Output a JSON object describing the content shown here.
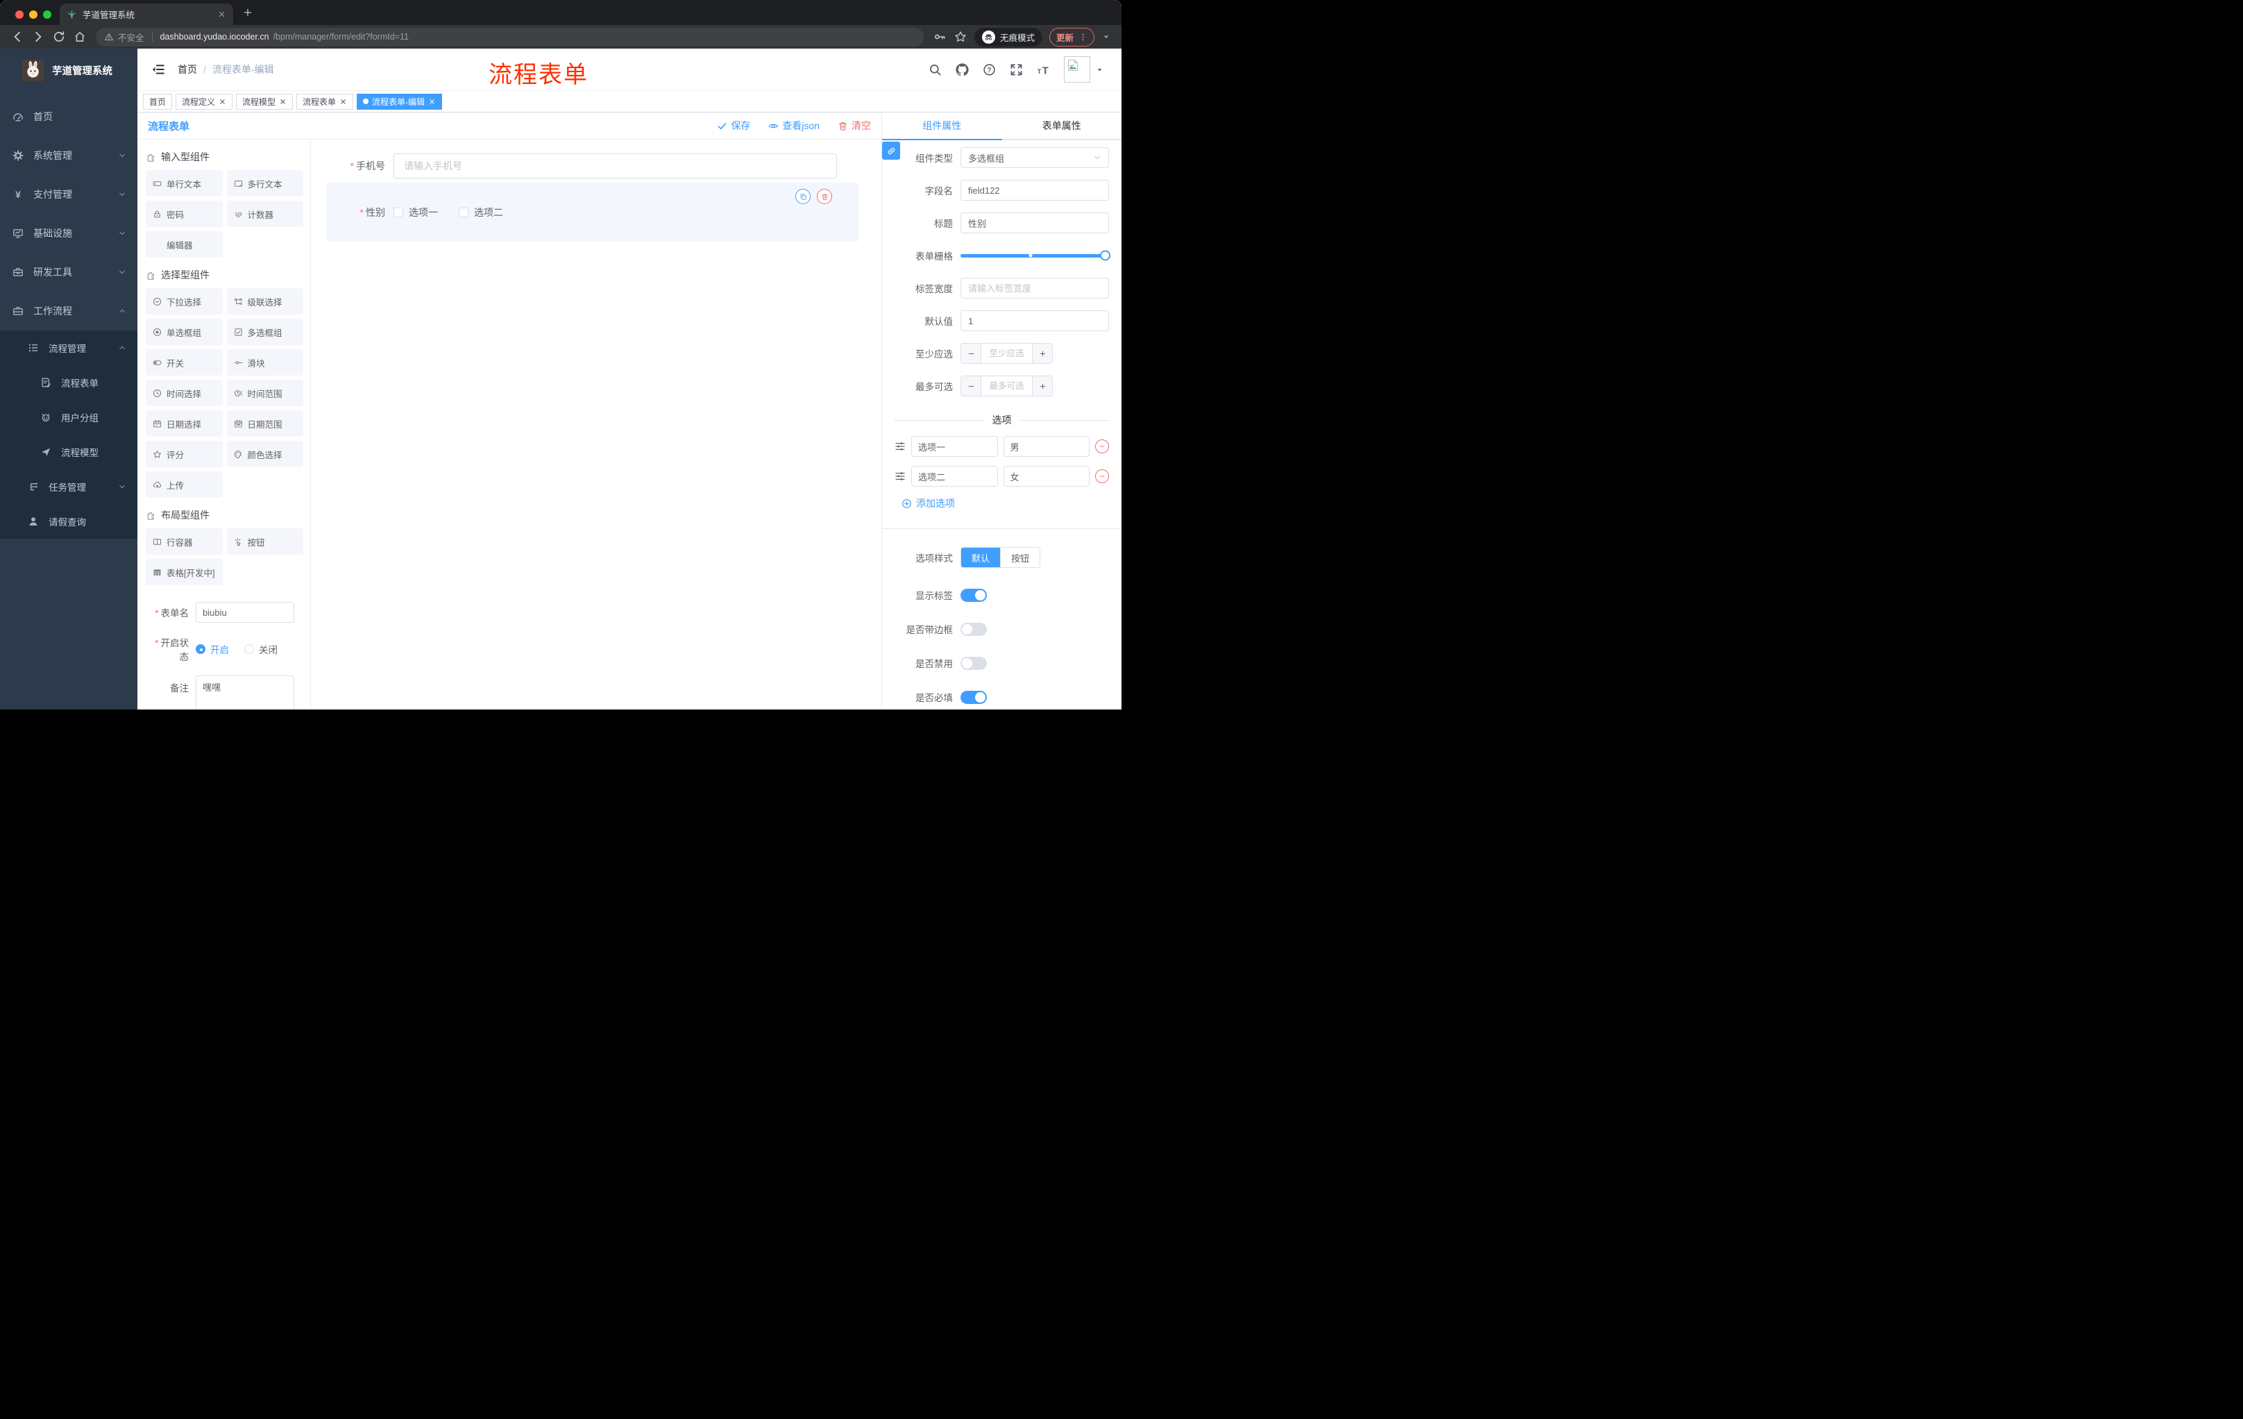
{
  "browser": {
    "tab_title": "芋道管理系统",
    "security_label": "不安全",
    "url_host": "dashboard.yudao.iocoder.cn",
    "url_path": "/bpm/manager/form/edit?formId=11",
    "incognito_label": "无痕模式",
    "update_label": "更新"
  },
  "sidebar": {
    "app_title": "芋道管理系统",
    "menu": [
      {
        "label": "首页",
        "icon": "dashboard",
        "level": 1
      },
      {
        "label": "系统管理",
        "icon": "gear",
        "level": 1,
        "chevron": "chev-down"
      },
      {
        "label": "支付管理",
        "icon": "yen",
        "level": 1,
        "chevron": "chev-down"
      },
      {
        "label": "基础设施",
        "icon": "monitor",
        "level": 1,
        "chevron": "chev-down"
      },
      {
        "label": "研发工具",
        "icon": "toolbox",
        "level": 1,
        "chevron": "chev-down"
      },
      {
        "label": "工作流程",
        "icon": "briefcase",
        "level": 1,
        "chevron": "chev-up"
      },
      {
        "label": "流程管理",
        "icon": "list-tree",
        "level": 2,
        "chevron": "chev-up",
        "dark": true
      },
      {
        "label": "流程表单",
        "icon": "doc-edit",
        "level": 3,
        "dark": true
      },
      {
        "label": "用户分组",
        "icon": "robot",
        "level": 3,
        "dark": true
      },
      {
        "label": "流程模型",
        "icon": "plane",
        "level": 3,
        "dark": true
      },
      {
        "label": "任务管理",
        "icon": "flow",
        "level": 2,
        "chevron": "chev-down",
        "dark": true
      },
      {
        "label": "请假查询",
        "icon": "user",
        "level": 2,
        "dark": true
      }
    ]
  },
  "navbar": {
    "breadcrumb_home": "首页",
    "breadcrumb_sep": "/",
    "breadcrumb_current": "流程表单-编辑",
    "watermark": "流程表单"
  },
  "tags": [
    {
      "label": "首页"
    },
    {
      "label": "流程定义",
      "closable": true
    },
    {
      "label": "流程模型",
      "closable": true
    },
    {
      "label": "流程表单",
      "closable": true
    },
    {
      "label": "流程表单-编辑",
      "closable": true,
      "active": true
    }
  ],
  "toolbar": {
    "title": "流程表单",
    "save_label": "保存",
    "view_json_label": "查看json",
    "clear_label": "清空"
  },
  "palette": {
    "sections": [
      {
        "title": "输入型组件",
        "items": [
          {
            "label": "单行文本",
            "icon": "input-single"
          },
          {
            "label": "多行文本",
            "icon": "input-multi"
          },
          {
            "label": "密码",
            "icon": "lock"
          },
          {
            "label": "计数器",
            "icon": "num123"
          },
          {
            "label": "编辑器",
            "icon": "none"
          }
        ]
      },
      {
        "title": "选择型组件",
        "items": [
          {
            "label": "下拉选择",
            "icon": "select"
          },
          {
            "label": "级联选择",
            "icon": "cascade"
          },
          {
            "label": "单选框组",
            "icon": "radio"
          },
          {
            "label": "多选框组",
            "icon": "checkbox"
          },
          {
            "label": "开关",
            "icon": "switch-ic"
          },
          {
            "label": "滑块",
            "icon": "slider-ic"
          },
          {
            "label": "时间选择",
            "icon": "clock"
          },
          {
            "label": "时间范围",
            "icon": "clock-range"
          },
          {
            "label": "日期选择",
            "icon": "calendar"
          },
          {
            "label": "日期范围",
            "icon": "calendar-range"
          },
          {
            "label": "评分",
            "icon": "star"
          },
          {
            "label": "颜色选择",
            "icon": "palette-ic"
          },
          {
            "label": "上传",
            "icon": "upload"
          }
        ]
      },
      {
        "title": "布局型组件",
        "items": [
          {
            "label": "行容器",
            "icon": "row-ic"
          },
          {
            "label": "按钮",
            "icon": "pointer"
          },
          {
            "label": "表格[开发中]",
            "icon": "table-ic"
          }
        ]
      }
    ],
    "form": {
      "name_label": "表单名",
      "name_value": "biubiu",
      "status_label": "开启状态",
      "status_on": "开启",
      "status_off": "关闭",
      "remark_label": "备注",
      "remark_value": "嘿嘿"
    }
  },
  "canvas": {
    "phone_label": "手机号",
    "phone_placeholder": "请输入手机号",
    "gender_label": "性别",
    "gender_opt1": "选项一",
    "gender_opt2": "选项二"
  },
  "props": {
    "tab_component": "组件属性",
    "tab_form": "表单属性",
    "type_label": "组件类型",
    "type_value": "多选框组",
    "field_label": "字段名",
    "field_value": "field122",
    "title_label": "标题",
    "title_value": "性别",
    "grid_label": "表单栅格",
    "width_label": "标签宽度",
    "width_placeholder": "请输入标签宽度",
    "default_label": "默认值",
    "default_value": "1",
    "min_label": "至少应选",
    "min_placeholder": "至少应选",
    "max_label": "最多可选",
    "max_placeholder": "最多可选",
    "options_title": "选项",
    "options": [
      {
        "name": "选项一",
        "value": "男"
      },
      {
        "name": "选项二",
        "value": "女"
      }
    ],
    "add_option": "添加选项",
    "style_label": "选项样式",
    "style_default": "默认",
    "style_button": "按钮",
    "toggles": [
      {
        "label": "显示标签",
        "on": true
      },
      {
        "label": "是否带边框",
        "on": false
      },
      {
        "label": "是否禁用",
        "on": false
      },
      {
        "label": "是否必填",
        "on": true
      }
    ]
  },
  "colors": {
    "primary": "#409eff",
    "danger": "#f56c6c",
    "watermark_red": "#ff2f00",
    "sidebar_bg": "#2d3a4b",
    "sidebar_submenu_bg": "#1f2d3d",
    "active_tag_bg": "#409eff"
  }
}
